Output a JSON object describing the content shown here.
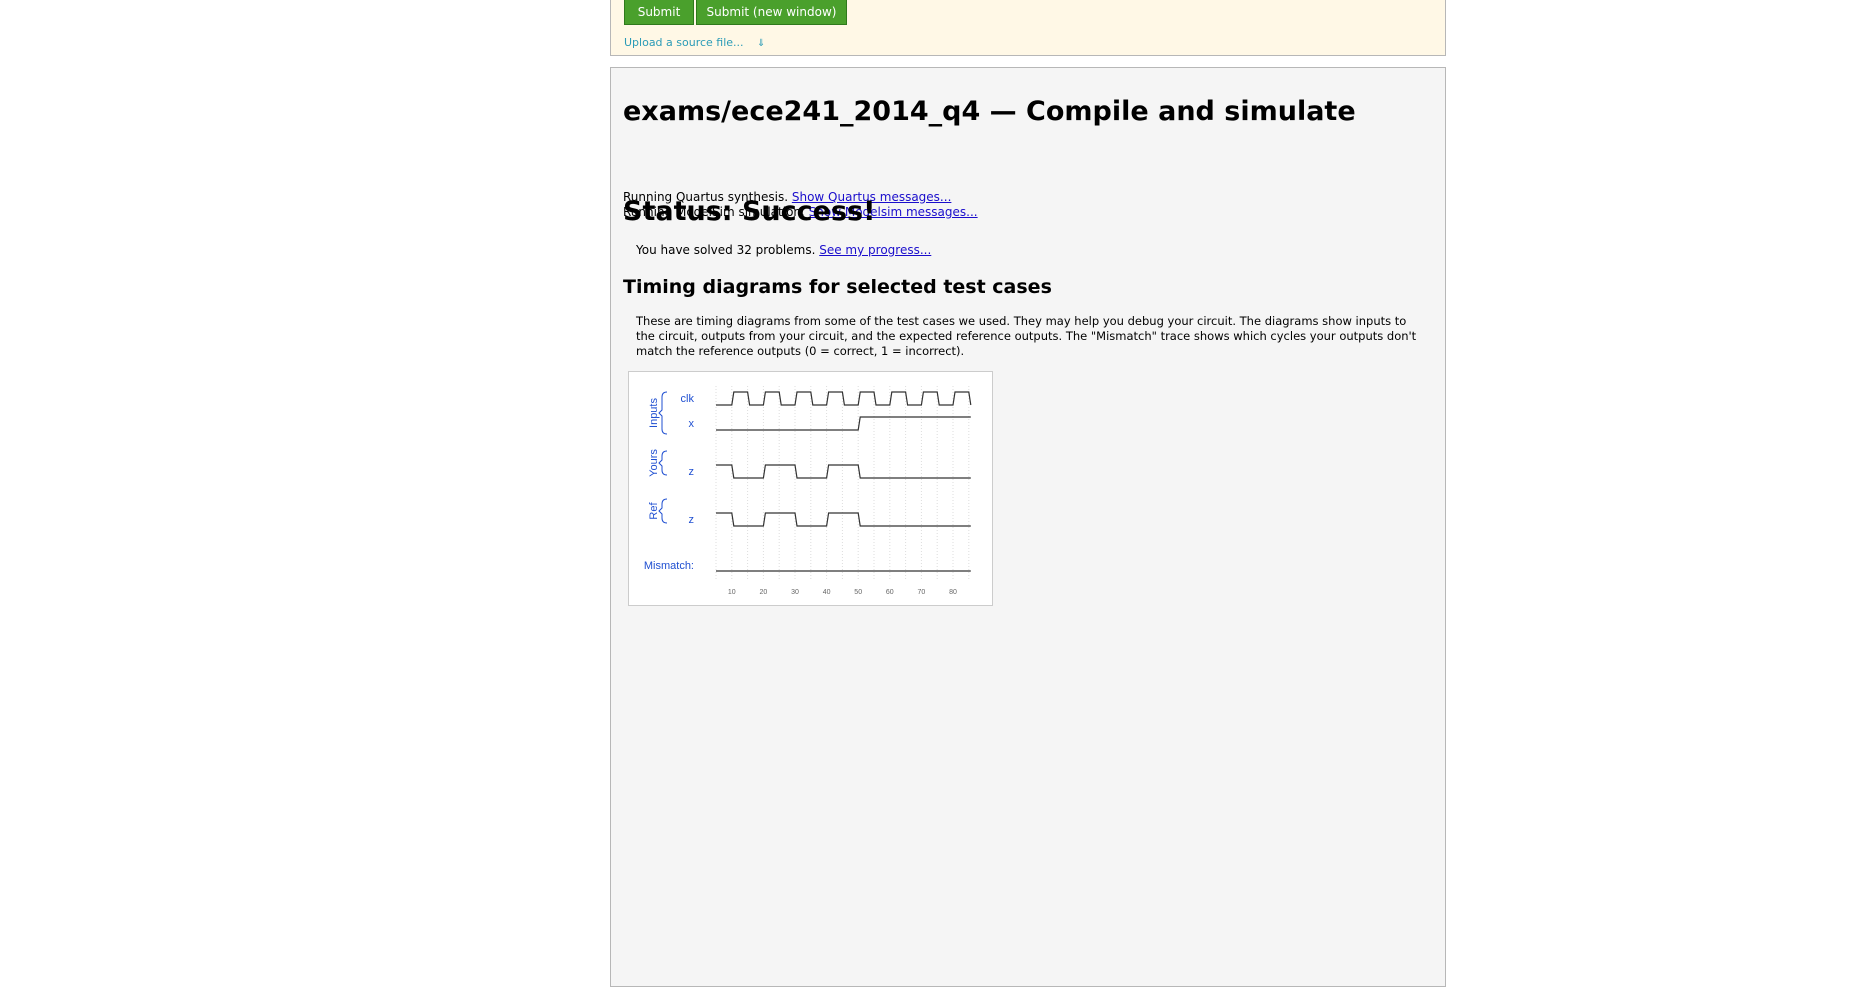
{
  "submit_panel": {
    "submit_label": "Submit",
    "submit_new_window_label": "Submit (new window)",
    "upload_label": "Upload a source file...",
    "upload_icon": "double-chevron-down-icon"
  },
  "result": {
    "title": "exams/ece241_2014_q4 — Compile and simulate",
    "quartus_text": "Running Quartus synthesis.",
    "quartus_link": "Show Quartus messages...",
    "modelsim_text": "Running ModelSim simulation.",
    "modelsim_link": "Show Modelsim messages...",
    "status": "Status: Success!",
    "solved_text": "You have solved 32 problems.",
    "progress_link": "See my progress...",
    "timing_title": "Timing diagrams for selected test cases",
    "timing_description": "These are timing diagrams from some of the test cases we used. They may help you debug your circuit. The diagrams show inputs to the circuit, outputs from your circuit, and the expected reference outputs. The \"Mismatch\" trace shows which cycles your outputs don't match the reference outputs (0 = correct, 1 = incorrect)."
  },
  "colors": {
    "button_green": "#4aa02c",
    "link_blue": "#1a0dcc",
    "waveform_label_blue": "#1f4fd1",
    "trace_gray": "#333333"
  },
  "timing_diagram": {
    "groups": [
      "Inputs",
      "Yours",
      "Ref"
    ],
    "signals": [
      {
        "group": "Inputs",
        "name": "clk",
        "levels": [
          0,
          1,
          0,
          1,
          0,
          1,
          0,
          1,
          0,
          1,
          0,
          1,
          0,
          1,
          0,
          1,
          0
        ]
      },
      {
        "group": "Inputs",
        "name": "x",
        "levels": [
          0,
          0,
          0,
          0,
          0,
          0,
          0,
          0,
          0,
          1,
          1,
          1,
          1,
          1,
          1,
          1,
          1
        ]
      },
      {
        "group": "Yours",
        "name": "z",
        "levels": [
          1,
          0,
          0,
          1,
          1,
          0,
          0,
          1,
          1,
          0,
          0,
          0,
          0,
          0,
          0,
          0,
          0
        ]
      },
      {
        "group": "Ref",
        "name": "z",
        "levels": [
          1,
          0,
          0,
          1,
          1,
          0,
          0,
          1,
          1,
          0,
          0,
          0,
          0,
          0,
          0,
          0,
          0
        ]
      }
    ],
    "mismatch_label": "Mismatch:",
    "mismatch_levels": [
      0,
      0,
      0,
      0,
      0,
      0,
      0,
      0,
      0,
      0,
      0,
      0,
      0,
      0,
      0,
      0,
      0
    ],
    "time_ticks": [
      "10",
      "20",
      "30",
      "40",
      "50",
      "60",
      "70",
      "80"
    ]
  }
}
